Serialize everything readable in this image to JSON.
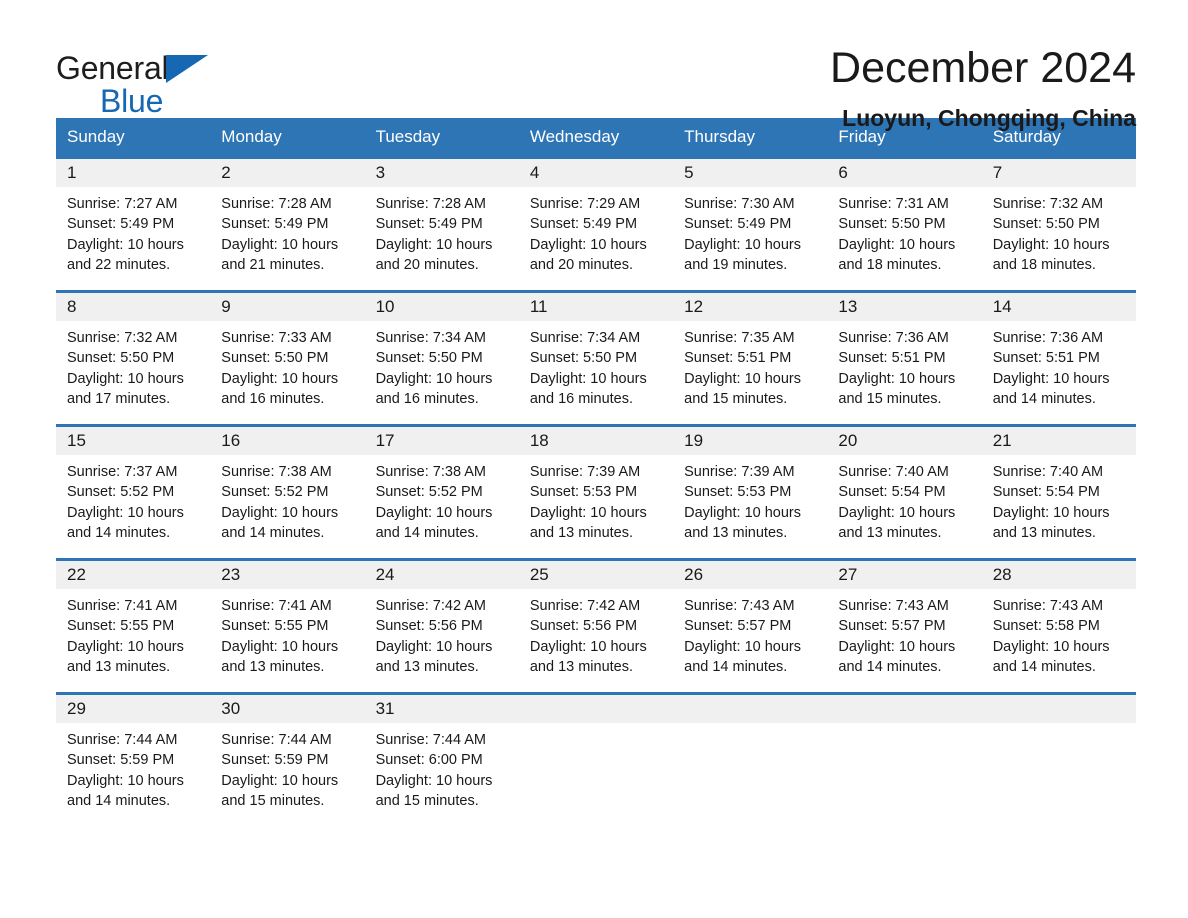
{
  "brand": {
    "word1": "General",
    "word2": "Blue",
    "triangle_color": "#1668b3",
    "logo_icon": "general-blue-triangle-logo"
  },
  "header": {
    "title": "December 2024",
    "subtitle": "Luoyun, Chongqing, China"
  },
  "theme": {
    "header_blue": "#2e75b6",
    "row_border_blue": "#2e75b6",
    "daynum_background": "#f0f0f0",
    "text": "#1a1a1a"
  },
  "weekday_headers": [
    "Sunday",
    "Monday",
    "Tuesday",
    "Wednesday",
    "Thursday",
    "Friday",
    "Saturday"
  ],
  "weeks": [
    [
      {
        "day": "1",
        "sunrise": "Sunrise: 7:27 AM",
        "sunset": "Sunset: 5:49 PM",
        "daylight_1": "Daylight: 10 hours",
        "daylight_2": "and 22 minutes."
      },
      {
        "day": "2",
        "sunrise": "Sunrise: 7:28 AM",
        "sunset": "Sunset: 5:49 PM",
        "daylight_1": "Daylight: 10 hours",
        "daylight_2": "and 21 minutes."
      },
      {
        "day": "3",
        "sunrise": "Sunrise: 7:28 AM",
        "sunset": "Sunset: 5:49 PM",
        "daylight_1": "Daylight: 10 hours",
        "daylight_2": "and 20 minutes."
      },
      {
        "day": "4",
        "sunrise": "Sunrise: 7:29 AM",
        "sunset": "Sunset: 5:49 PM",
        "daylight_1": "Daylight: 10 hours",
        "daylight_2": "and 20 minutes."
      },
      {
        "day": "5",
        "sunrise": "Sunrise: 7:30 AM",
        "sunset": "Sunset: 5:49 PM",
        "daylight_1": "Daylight: 10 hours",
        "daylight_2": "and 19 minutes."
      },
      {
        "day": "6",
        "sunrise": "Sunrise: 7:31 AM",
        "sunset": "Sunset: 5:50 PM",
        "daylight_1": "Daylight: 10 hours",
        "daylight_2": "and 18 minutes."
      },
      {
        "day": "7",
        "sunrise": "Sunrise: 7:32 AM",
        "sunset": "Sunset: 5:50 PM",
        "daylight_1": "Daylight: 10 hours",
        "daylight_2": "and 18 minutes."
      }
    ],
    [
      {
        "day": "8",
        "sunrise": "Sunrise: 7:32 AM",
        "sunset": "Sunset: 5:50 PM",
        "daylight_1": "Daylight: 10 hours",
        "daylight_2": "and 17 minutes."
      },
      {
        "day": "9",
        "sunrise": "Sunrise: 7:33 AM",
        "sunset": "Sunset: 5:50 PM",
        "daylight_1": "Daylight: 10 hours",
        "daylight_2": "and 16 minutes."
      },
      {
        "day": "10",
        "sunrise": "Sunrise: 7:34 AM",
        "sunset": "Sunset: 5:50 PM",
        "daylight_1": "Daylight: 10 hours",
        "daylight_2": "and 16 minutes."
      },
      {
        "day": "11",
        "sunrise": "Sunrise: 7:34 AM",
        "sunset": "Sunset: 5:50 PM",
        "daylight_1": "Daylight: 10 hours",
        "daylight_2": "and 16 minutes."
      },
      {
        "day": "12",
        "sunrise": "Sunrise: 7:35 AM",
        "sunset": "Sunset: 5:51 PM",
        "daylight_1": "Daylight: 10 hours",
        "daylight_2": "and 15 minutes."
      },
      {
        "day": "13",
        "sunrise": "Sunrise: 7:36 AM",
        "sunset": "Sunset: 5:51 PM",
        "daylight_1": "Daylight: 10 hours",
        "daylight_2": "and 15 minutes."
      },
      {
        "day": "14",
        "sunrise": "Sunrise: 7:36 AM",
        "sunset": "Sunset: 5:51 PM",
        "daylight_1": "Daylight: 10 hours",
        "daylight_2": "and 14 minutes."
      }
    ],
    [
      {
        "day": "15",
        "sunrise": "Sunrise: 7:37 AM",
        "sunset": "Sunset: 5:52 PM",
        "daylight_1": "Daylight: 10 hours",
        "daylight_2": "and 14 minutes."
      },
      {
        "day": "16",
        "sunrise": "Sunrise: 7:38 AM",
        "sunset": "Sunset: 5:52 PM",
        "daylight_1": "Daylight: 10 hours",
        "daylight_2": "and 14 minutes."
      },
      {
        "day": "17",
        "sunrise": "Sunrise: 7:38 AM",
        "sunset": "Sunset: 5:52 PM",
        "daylight_1": "Daylight: 10 hours",
        "daylight_2": "and 14 minutes."
      },
      {
        "day": "18",
        "sunrise": "Sunrise: 7:39 AM",
        "sunset": "Sunset: 5:53 PM",
        "daylight_1": "Daylight: 10 hours",
        "daylight_2": "and 13 minutes."
      },
      {
        "day": "19",
        "sunrise": "Sunrise: 7:39 AM",
        "sunset": "Sunset: 5:53 PM",
        "daylight_1": "Daylight: 10 hours",
        "daylight_2": "and 13 minutes."
      },
      {
        "day": "20",
        "sunrise": "Sunrise: 7:40 AM",
        "sunset": "Sunset: 5:54 PM",
        "daylight_1": "Daylight: 10 hours",
        "daylight_2": "and 13 minutes."
      },
      {
        "day": "21",
        "sunrise": "Sunrise: 7:40 AM",
        "sunset": "Sunset: 5:54 PM",
        "daylight_1": "Daylight: 10 hours",
        "daylight_2": "and 13 minutes."
      }
    ],
    [
      {
        "day": "22",
        "sunrise": "Sunrise: 7:41 AM",
        "sunset": "Sunset: 5:55 PM",
        "daylight_1": "Daylight: 10 hours",
        "daylight_2": "and 13 minutes."
      },
      {
        "day": "23",
        "sunrise": "Sunrise: 7:41 AM",
        "sunset": "Sunset: 5:55 PM",
        "daylight_1": "Daylight: 10 hours",
        "daylight_2": "and 13 minutes."
      },
      {
        "day": "24",
        "sunrise": "Sunrise: 7:42 AM",
        "sunset": "Sunset: 5:56 PM",
        "daylight_1": "Daylight: 10 hours",
        "daylight_2": "and 13 minutes."
      },
      {
        "day": "25",
        "sunrise": "Sunrise: 7:42 AM",
        "sunset": "Sunset: 5:56 PM",
        "daylight_1": "Daylight: 10 hours",
        "daylight_2": "and 13 minutes."
      },
      {
        "day": "26",
        "sunrise": "Sunrise: 7:43 AM",
        "sunset": "Sunset: 5:57 PM",
        "daylight_1": "Daylight: 10 hours",
        "daylight_2": "and 14 minutes."
      },
      {
        "day": "27",
        "sunrise": "Sunrise: 7:43 AM",
        "sunset": "Sunset: 5:57 PM",
        "daylight_1": "Daylight: 10 hours",
        "daylight_2": "and 14 minutes."
      },
      {
        "day": "28",
        "sunrise": "Sunrise: 7:43 AM",
        "sunset": "Sunset: 5:58 PM",
        "daylight_1": "Daylight: 10 hours",
        "daylight_2": "and 14 minutes."
      }
    ],
    [
      {
        "day": "29",
        "sunrise": "Sunrise: 7:44 AM",
        "sunset": "Sunset: 5:59 PM",
        "daylight_1": "Daylight: 10 hours",
        "daylight_2": "and 14 minutes."
      },
      {
        "day": "30",
        "sunrise": "Sunrise: 7:44 AM",
        "sunset": "Sunset: 5:59 PM",
        "daylight_1": "Daylight: 10 hours",
        "daylight_2": "and 15 minutes."
      },
      {
        "day": "31",
        "sunrise": "Sunrise: 7:44 AM",
        "sunset": "Sunset: 6:00 PM",
        "daylight_1": "Daylight: 10 hours",
        "daylight_2": "and 15 minutes."
      },
      {
        "day": "",
        "sunrise": "",
        "sunset": "",
        "daylight_1": "",
        "daylight_2": ""
      },
      {
        "day": "",
        "sunrise": "",
        "sunset": "",
        "daylight_1": "",
        "daylight_2": ""
      },
      {
        "day": "",
        "sunrise": "",
        "sunset": "",
        "daylight_1": "",
        "daylight_2": ""
      },
      {
        "day": "",
        "sunrise": "",
        "sunset": "",
        "daylight_1": "",
        "daylight_2": ""
      }
    ]
  ]
}
